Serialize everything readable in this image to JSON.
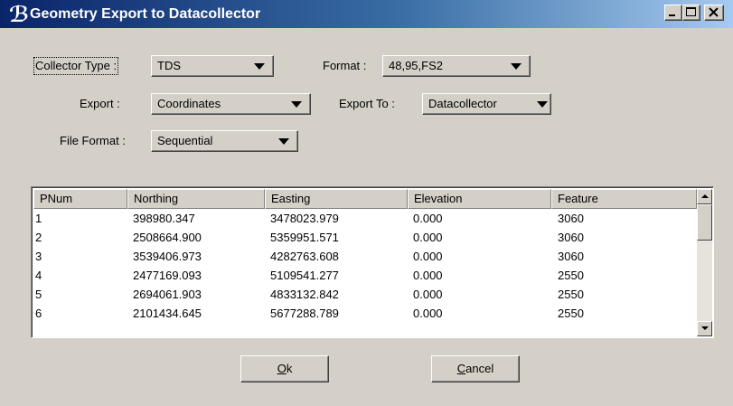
{
  "window": {
    "title": "Geometry Export to Datacollector",
    "icon": "app-logo-icon"
  },
  "form": {
    "collector_type": {
      "label": "Collector Type :",
      "value": "TDS"
    },
    "format": {
      "label": "Format :",
      "value": "48,95,FS2"
    },
    "export": {
      "label": "Export :",
      "value": "Coordinates"
    },
    "export_to": {
      "label": "Export To :",
      "value": "Datacollector"
    },
    "file_format": {
      "label": "File Format :",
      "value": "Sequential"
    }
  },
  "tools": [
    "select-point-icon",
    "pick-element-icon"
  ],
  "table": {
    "columns": [
      "PNum",
      "Northing",
      "Easting",
      "Elevation",
      "Feature"
    ],
    "rows": [
      [
        "1",
        "398980.347",
        "3478023.979",
        "0.000",
        "3060"
      ],
      [
        "2",
        "2508664.900",
        "5359951.571",
        "0.000",
        "3060"
      ],
      [
        "3",
        "3539406.973",
        "4282763.608",
        "0.000",
        "3060"
      ],
      [
        "4",
        "2477169.093",
        "5109541.277",
        "0.000",
        "2550"
      ],
      [
        "5",
        "2694061.903",
        "4833132.842",
        "0.000",
        "2550"
      ],
      [
        "6",
        "2101434.645",
        "5677288.789",
        "0.000",
        "2550"
      ]
    ]
  },
  "buttons": {
    "ok": {
      "mnemonic": "O",
      "rest": "k"
    },
    "cancel": {
      "mnemonic": "C",
      "rest": "ancel"
    }
  },
  "colors": {
    "titlebar_start": "#0a246a",
    "titlebar_end": "#a6caf0",
    "face": "#d4d0c8"
  }
}
